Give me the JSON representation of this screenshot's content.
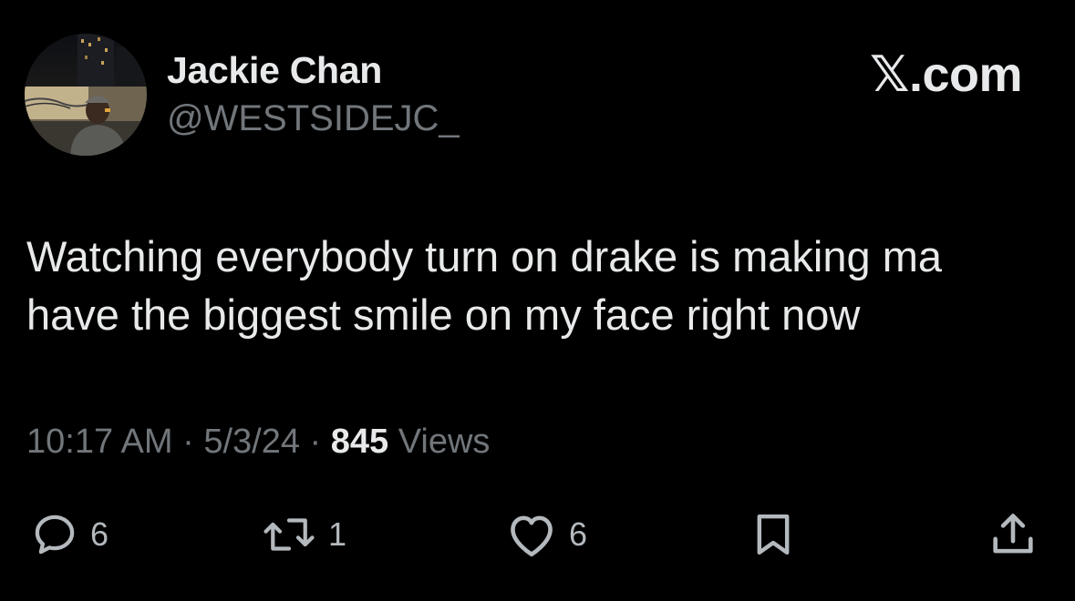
{
  "author": {
    "display_name": "Jackie Chan",
    "handle": "@WESTSIDEJC_",
    "avatar_icon": "profile-photo"
  },
  "brand": {
    "mark": "𝕏",
    "suffix": ".com"
  },
  "tweet": {
    "lines": [
      "Watching everybody turn on drake is making ma",
      "have the biggest smile on my face right now"
    ]
  },
  "meta": {
    "time": "10:17 AM",
    "sep1": " · ",
    "date": "5/3/24",
    "sep2": " · ",
    "views_count": "845",
    "views_label": " Views"
  },
  "actions": {
    "replies": "6",
    "reposts": "1",
    "likes": "6"
  },
  "colors": {
    "background": "#000000",
    "primary_text": "#e7e9ea",
    "secondary_text": "#71767b",
    "icon": "#b4b9be"
  }
}
